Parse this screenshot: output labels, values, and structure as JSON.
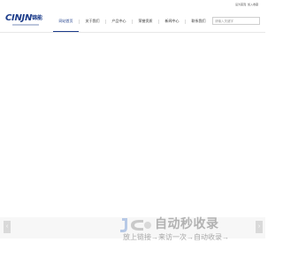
{
  "top_links": {
    "link_1": "设为首页",
    "link_2": "加入收藏"
  },
  "logo": {
    "wordmark": "CINJN",
    "chinese": "锦能"
  },
  "nav": {
    "items": [
      {
        "label": "网站首页"
      },
      {
        "label": "关于我们"
      },
      {
        "label": "产品中心"
      },
      {
        "label": "荣誉资质"
      },
      {
        "label": "新闻中心"
      },
      {
        "label": "联系我们"
      }
    ],
    "active_index": 0
  },
  "search": {
    "placeholder": "请输入关键字"
  },
  "slider": {
    "prev_label": "‹",
    "next_label": "›"
  },
  "watermark": {
    "title": "自动秒收录",
    "subtitle": "放上链接→来访一次→自动收录→"
  },
  "colors": {
    "brand": "#1c3c8a",
    "watermark": "#b2b2b2"
  }
}
